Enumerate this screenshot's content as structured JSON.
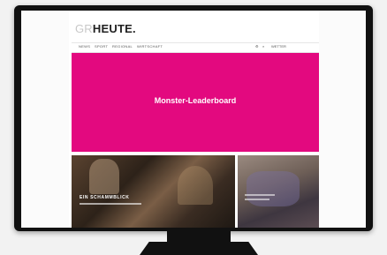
{
  "site": {
    "logo_prefix": "GR",
    "logo_main": "HEUTE."
  },
  "nav": {
    "items": [
      "NEWS",
      "SPORT",
      "REGIONAL",
      "WIRTSCHAFT"
    ],
    "right_item": "WETTER"
  },
  "ad": {
    "label": "Monster-Leaderboard",
    "color": "#e3097f"
  },
  "teasers": {
    "left_title": "EIN SCHAMMBLICK"
  }
}
